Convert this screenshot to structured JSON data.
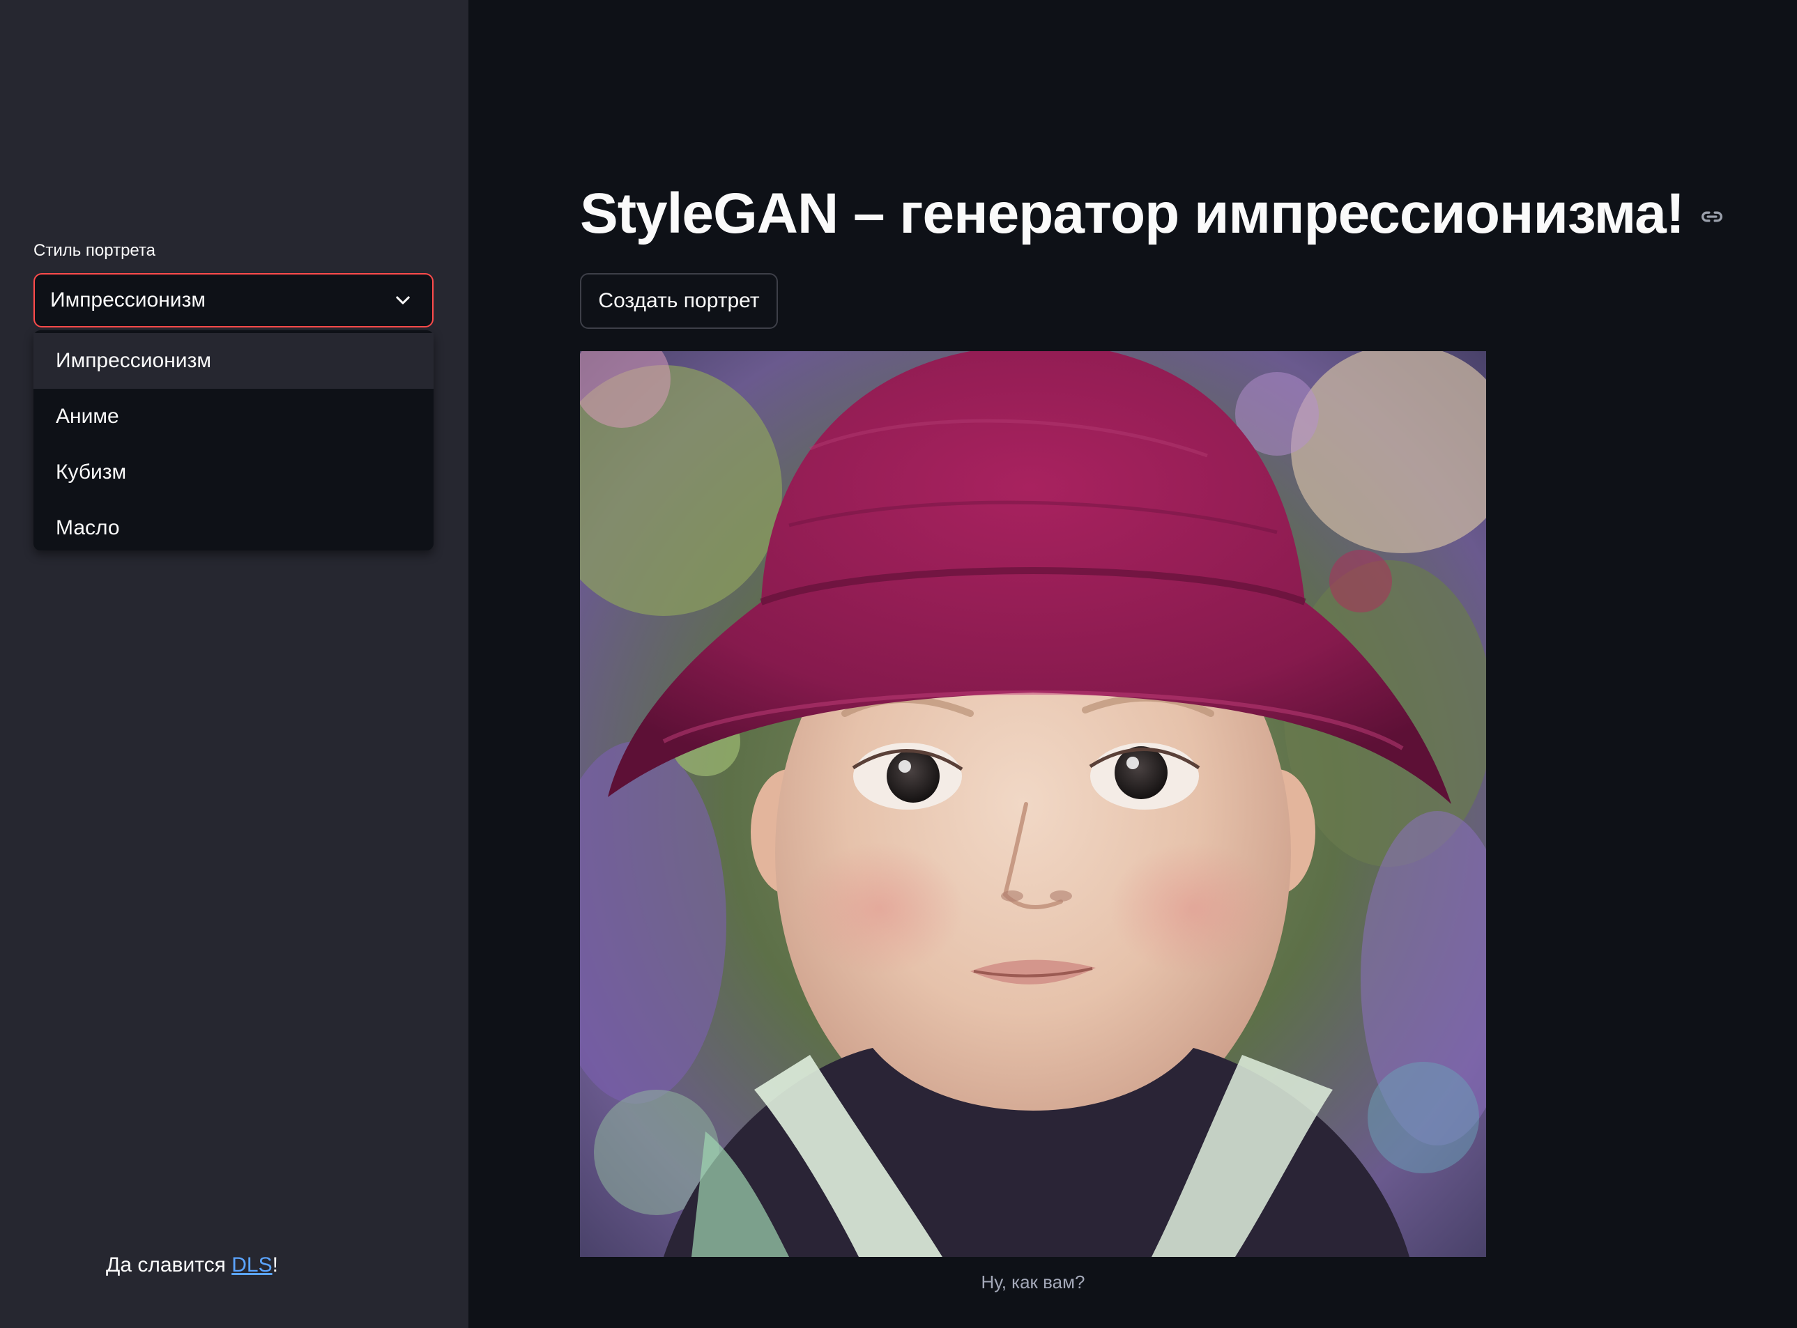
{
  "sidebar": {
    "select_label": "Стиль портрета",
    "selected_value": "Импрессионизм",
    "options": [
      "Импрессионизм",
      "Аниме",
      "Кубизм",
      "Масло"
    ],
    "footer": {
      "prefix": "Да славится ",
      "link_text": "DLS",
      "suffix": "!"
    }
  },
  "main": {
    "title": "StyleGAN – генератор импрессионизма!",
    "create_button_label": "Создать портрет",
    "image_alt": "Сгенерированный портрет",
    "caption": "Ну, как вам?"
  },
  "colors": {
    "app_background": "#0e1117",
    "sidebar_background": "#262730",
    "accent": "#ff4b4b",
    "link": "#5ba4ff",
    "text": "#fafafa"
  },
  "icons": {
    "select_toggle": "chevron-down-icon",
    "title_anchor": "link-icon"
  }
}
